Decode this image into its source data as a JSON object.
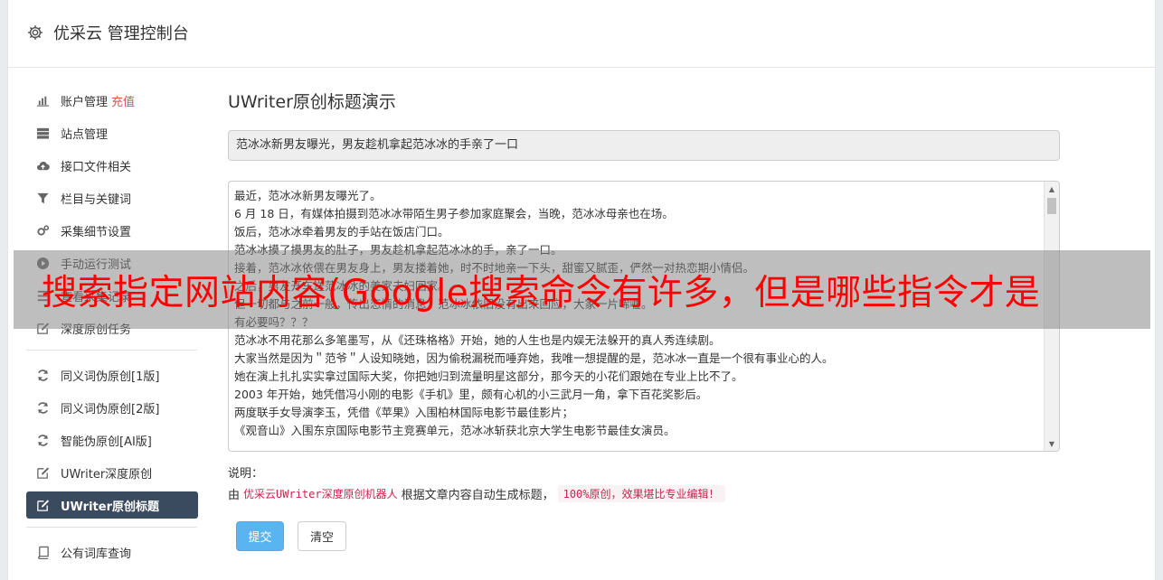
{
  "header": {
    "title": "优采云 管理控制台"
  },
  "sidebar": {
    "groups": [
      [
        {
          "label": "账户管理",
          "badge": "充值",
          "icon": "bar-chart-icon"
        },
        {
          "label": "站点管理",
          "icon": "server-icon"
        },
        {
          "label": "接口文件相关",
          "icon": "cloud-upload-icon"
        },
        {
          "label": "栏目与关键词",
          "icon": "filter-icon"
        },
        {
          "label": "采集细节设置",
          "icon": "cogs-icon"
        },
        {
          "label": "手动运行测试",
          "icon": "play-icon"
        },
        {
          "label": "查看采集记录",
          "icon": "list-icon"
        },
        {
          "label": "深度原创任务",
          "icon": "edit-icon"
        }
      ],
      [
        {
          "label": "同义词伪原创[1版]",
          "icon": "refresh-icon"
        },
        {
          "label": "同义词伪原创[2版]",
          "icon": "refresh-icon"
        },
        {
          "label": "智能伪原创[AI版]",
          "icon": "refresh-icon"
        },
        {
          "label": "UWriter深度原创",
          "icon": "edit-icon"
        },
        {
          "label": "UWriter原创标题",
          "icon": "edit-icon",
          "active": true
        }
      ],
      [
        {
          "label": "公有词库查询",
          "icon": "book-icon"
        }
      ]
    ]
  },
  "main": {
    "title": "UWriter原创标题演示",
    "title_value": "范冰冰新男友曝光，男友趁机拿起范冰冰的手亲了一口",
    "content_lines": [
      "最近，范冰冰新男友曝光了。",
      "6 月 18 日，有媒体拍摄到范冰冰带陌生男子参加家庭聚会，当晚，范冰冰母亲也在场。",
      "饭后，范冰冰牵着男友的手站在饭店门口。",
      "范冰冰摸了摸男友的肚子，男友趁机拿起范冰冰的手，亲了一口。",
      "接着，范冰冰依偎在男友身上，男友搂着她，时不时地亲一下头，甜蜜又腻歪，俨然一对热恋期小情侣。",
      "之后，男友开车送范冰冰的姜家夫妇回家。",
      "但一切都与之前一般，传出恋情的消息，范冰冰依旧没有出来回应，大家一片唏嘘。",
      "有必要吗？？？",
      "范冰冰不用花那么多笔墨写，从《还珠格格》开始，她的人生也是内娱无法躲开的真人秀连续剧。",
      "大家当然是因为＂范爷＂人设知晓她，因为偷税漏税而唾弃她，我唯一想提醒的是，范冰冰一直是一个很有事业心的人。",
      "她在演上扎扎实实拿过国际大奖，你把她归到流量明星这部分，那今天的小花们跟她在专业上比不了。",
      "2003 年开始，她凭借冯小刚的电影《手机》里，颇有心机的小三武月一角，拿下百花奖影后。",
      "两度联手女导演李玉，凭借《苹果》入围柏林国际电影节最佳影片；",
      "《观音山》入围东京国际电影节主竞赛单元，范冰冰斩获北京大学生电影节最佳女演员。"
    ],
    "note_label": "说明：",
    "note_prefix": "由",
    "note_code": "优采云UWriter深度原创机器人",
    "note_middle": "根据文章内容自动生成标题，",
    "note_pill": "100%原创，效果堪比专业编辑！",
    "submit_label": "提交",
    "clear_label": "清空"
  },
  "overlay": {
    "text": "搜索指定网站内容(Google搜索命令有许多，但是哪些指令才是"
  },
  "colors": {
    "active_nav": "#3b4b5f",
    "primary": "#5ab4f0",
    "accent_red": "#d9534f",
    "overlay_text": "#ff0000"
  }
}
